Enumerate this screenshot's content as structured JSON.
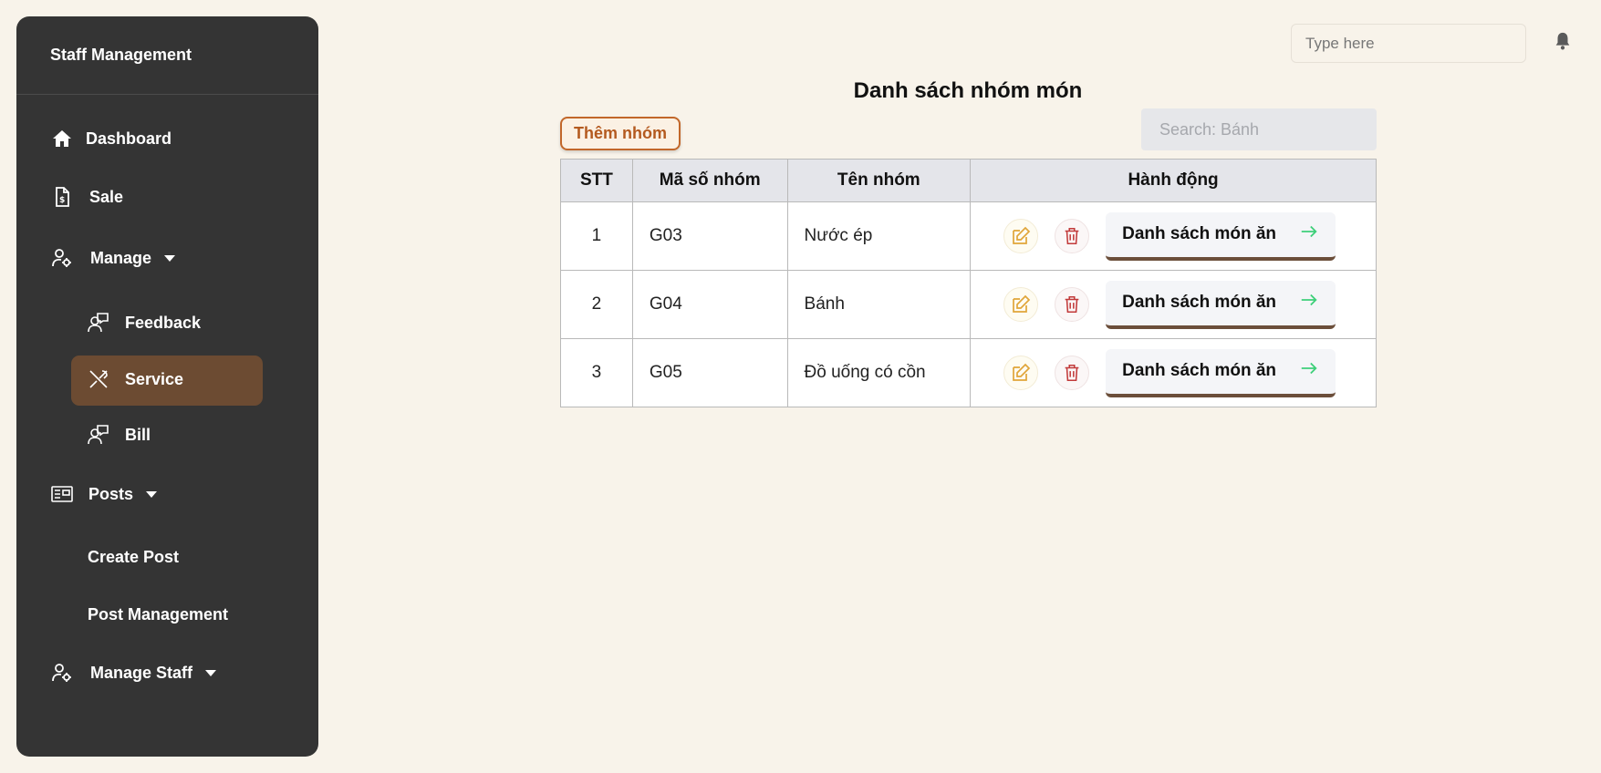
{
  "sidebar": {
    "title": "Staff Management",
    "items": [
      {
        "label": "Dashboard",
        "icon": "home-icon"
      },
      {
        "label": "Sale",
        "icon": "invoice-dollar-icon"
      },
      {
        "label": "Manage",
        "icon": "user-gear-icon"
      },
      {
        "label": "Feedback",
        "icon": "user-chat-icon"
      },
      {
        "label": "Service",
        "icon": "utensils-icon",
        "active": true
      },
      {
        "label": "Bill",
        "icon": "user-chat-icon"
      },
      {
        "label": "Posts",
        "icon": "newspaper-icon"
      },
      {
        "label": "Create Post"
      },
      {
        "label": "Post Management"
      },
      {
        "label": "Manage Staff",
        "icon": "user-gear-icon"
      }
    ]
  },
  "topbar": {
    "search_placeholder": "Type here",
    "notification_icon": "bell-icon"
  },
  "main": {
    "title": "Danh sách nhóm món",
    "add_button": "Thêm nhóm",
    "search_placeholder": "Search: Bánh",
    "table": {
      "headers": [
        "STT",
        "Mã số nhóm",
        "Tên nhóm",
        "Hành động"
      ],
      "rows": [
        {
          "stt": "1",
          "code": "G03",
          "name": "Nước ép",
          "action": "Danh sách món ăn"
        },
        {
          "stt": "2",
          "code": "G04",
          "name": "Bánh",
          "action": "Danh sách món ăn"
        },
        {
          "stt": "3",
          "code": "G05",
          "name": "Đồ uống có cồn",
          "action": "Danh sách món ăn"
        }
      ]
    }
  },
  "colors": {
    "background": "#f8f3ea",
    "sidebar": "#343434",
    "active_item": "#6c4b32",
    "accent_orange": "#c2672a",
    "edit_icon": "#e0a53a",
    "delete_icon": "#c23b3b",
    "arrow": "#3ecf7a"
  }
}
